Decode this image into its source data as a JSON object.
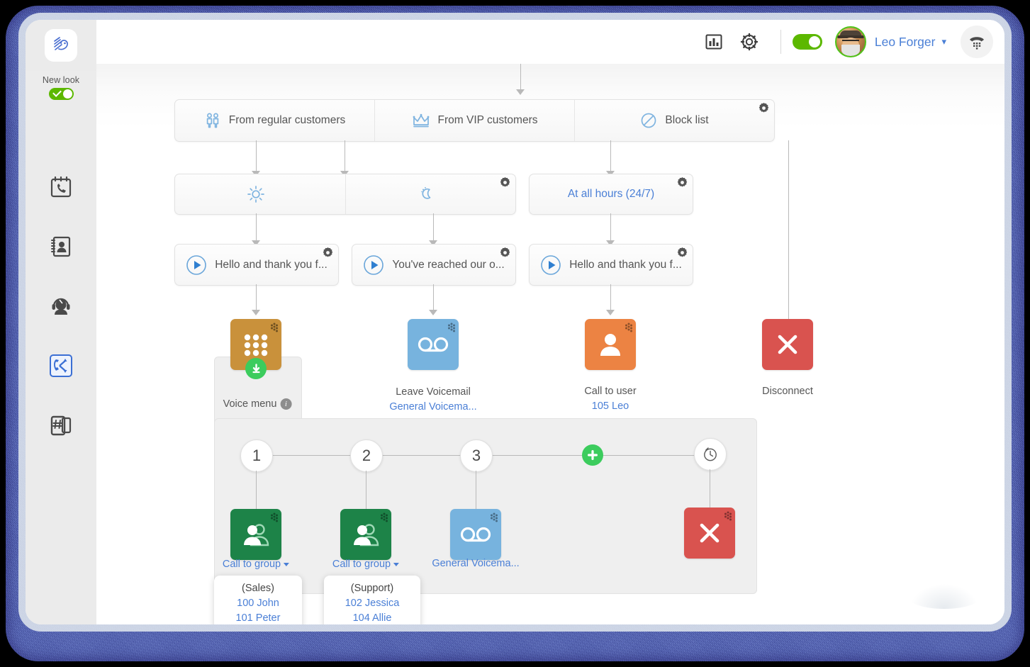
{
  "app": {
    "logo_icon": "zadarma-logo-icon",
    "new_look_label": "New look",
    "new_look_toggle_state": "on"
  },
  "sidebar": {
    "items": [
      {
        "name": "call-log",
        "icon": "phone-calendar-icon",
        "active": false
      },
      {
        "name": "contacts",
        "icon": "address-book-icon",
        "active": false
      },
      {
        "name": "agents",
        "icon": "headset-agent-icon",
        "active": false
      },
      {
        "name": "call-flow",
        "icon": "call-flow-icon",
        "active": true
      },
      {
        "name": "phone-numbers",
        "icon": "hash-phone-icon",
        "active": false
      }
    ]
  },
  "topbar": {
    "stats_icon": "bar-chart-icon",
    "settings_icon": "gear-icon",
    "availability_toggle": "on",
    "user_name": "Leo Forger",
    "user_chevron": "chevron-down-icon",
    "avatar_icon": "user-avatar",
    "dialpad_icon": "dialpad-handset-icon"
  },
  "flow": {
    "routing_row": [
      {
        "label": "From regular customers",
        "icon": "two-people-icon"
      },
      {
        "label": "From VIP customers",
        "icon": "crown-icon"
      },
      {
        "label": "Block list",
        "icon": "no-entry-icon",
        "gear": true
      }
    ],
    "schedule_row": [
      {
        "label": "",
        "icon": "sun-icon",
        "gear": false
      },
      {
        "label": "",
        "icon": "moon-icon",
        "gear": true
      },
      {
        "label": "At all hours (24/7)",
        "icon": "",
        "gear": true
      }
    ],
    "greeting_row": [
      {
        "label": "Hello and thank you f...",
        "icon": "play-icon",
        "gear": true
      },
      {
        "label": "You've reached our o...",
        "icon": "play-icon",
        "gear": true
      },
      {
        "label": "Hello and thank you f...",
        "icon": "play-icon",
        "gear": true
      }
    ],
    "action_row": [
      {
        "title": "Voice menu",
        "subtitle": "",
        "icon": "keypad-icon",
        "color": "#c9913b",
        "info": true,
        "badge": "download-badge"
      },
      {
        "title": "Leave Voicemail",
        "subtitle": "General Voicema...",
        "icon": "voicemail-icon",
        "color": "#77b3de"
      },
      {
        "title": "Call to user",
        "subtitle": "105 Leo",
        "icon": "single-user-icon",
        "color": "#ec8343"
      },
      {
        "title": "Disconnect",
        "subtitle": "",
        "icon": "x-icon",
        "color": "#d9534f"
      }
    ],
    "voice_menu": {
      "keys": [
        "1",
        "2",
        "3"
      ],
      "add_key_icon": "plus-icon",
      "timeout_icon": "clock-icon",
      "branches": [
        {
          "key": "1",
          "title": "Call to group",
          "has_caret": true,
          "icon": "group-icon",
          "color": "#1d8348",
          "tooltip": {
            "group": "(Sales)",
            "members": [
              "100 John",
              "101 Peter"
            ]
          }
        },
        {
          "key": "2",
          "title": "Call to group",
          "has_caret": true,
          "icon": "group-icon",
          "color": "#1d8348",
          "tooltip": {
            "group": "(Support)",
            "members": [
              "102 Jessica",
              "104 Allie"
            ]
          }
        },
        {
          "key": "3",
          "title": "General Voicema...",
          "has_caret": false,
          "icon": "voicemail-icon",
          "color": "#77b3de",
          "tooltip": null
        },
        {
          "key": "timeout",
          "title": "",
          "has_caret": false,
          "icon": "x-icon",
          "color": "#d9534f",
          "tooltip": null
        }
      ]
    }
  },
  "colors": {
    "accent_blue": "#4a7fd6",
    "green": "#5cb800",
    "red": "#d9534f",
    "orange": "#ec8343",
    "gold": "#c9913b",
    "light_blue": "#77b3de",
    "dark_green": "#1d8348",
    "frame": "#4b5bb4"
  }
}
